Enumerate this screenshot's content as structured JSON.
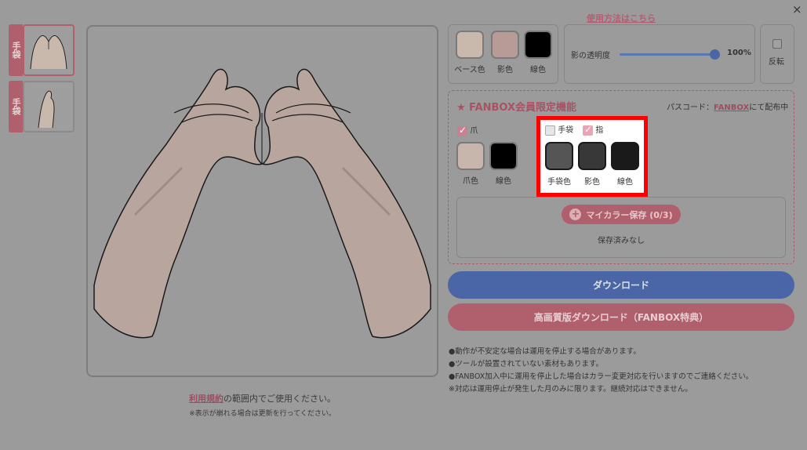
{
  "window": {
    "close_label": "×",
    "howto_link": "使用方法はこちら"
  },
  "thumbnails": [
    {
      "tag": "手袋",
      "selected": true
    },
    {
      "tag": "手袋",
      "selected": false
    }
  ],
  "footer": {
    "terms_link": "利用規約",
    "terms_text": "の範囲内でご使用ください。",
    "note": "※表示が崩れる場合は更新を行ってください。"
  },
  "colors": {
    "swatches": [
      {
        "label": "ベース色",
        "color": "#c9b8ac"
      },
      {
        "label": "影色",
        "color": "#b89b97"
      },
      {
        "label": "線色",
        "color": "#000000"
      }
    ],
    "shadow_label": "影の透明度",
    "shadow_value": "100%",
    "flip_label": "反転"
  },
  "fanbox": {
    "title": "★ FANBOX会員限定機能",
    "pass_prefix": "パスコード：",
    "pass_link": "FANBOX",
    "pass_suffix": "にて配布中",
    "nail_label": "爪",
    "nail_swatches": [
      {
        "label": "爪色",
        "color": "#c7b6ab"
      },
      {
        "label": "線色",
        "color": "#000000"
      }
    ],
    "glove_label": "手袋",
    "finger_label": "指",
    "glove_swatches": [
      {
        "label": "手袋色",
        "color": "#555555"
      },
      {
        "label": "影色",
        "color": "#383838"
      },
      {
        "label": "線色",
        "color": "#1a1a1a"
      }
    ],
    "mycolor_label": "マイカラー保存 (0/3)",
    "saved_text": "保存済みなし"
  },
  "buttons": {
    "download": "ダウンロード",
    "hq_download": "高画質版ダウンロード（FANBOX特典）"
  },
  "notes": [
    "●動作が不安定な場合は運用を停止する場合があります。",
    "●ツールが設置されていない素材もあります。",
    "●FANBOX加入中に運用を停止した場合はカラー変更対応を行いますのでご連絡ください。",
    "※対応は運用停止が発生した月のみに限ります。継続対応はできません。"
  ]
}
